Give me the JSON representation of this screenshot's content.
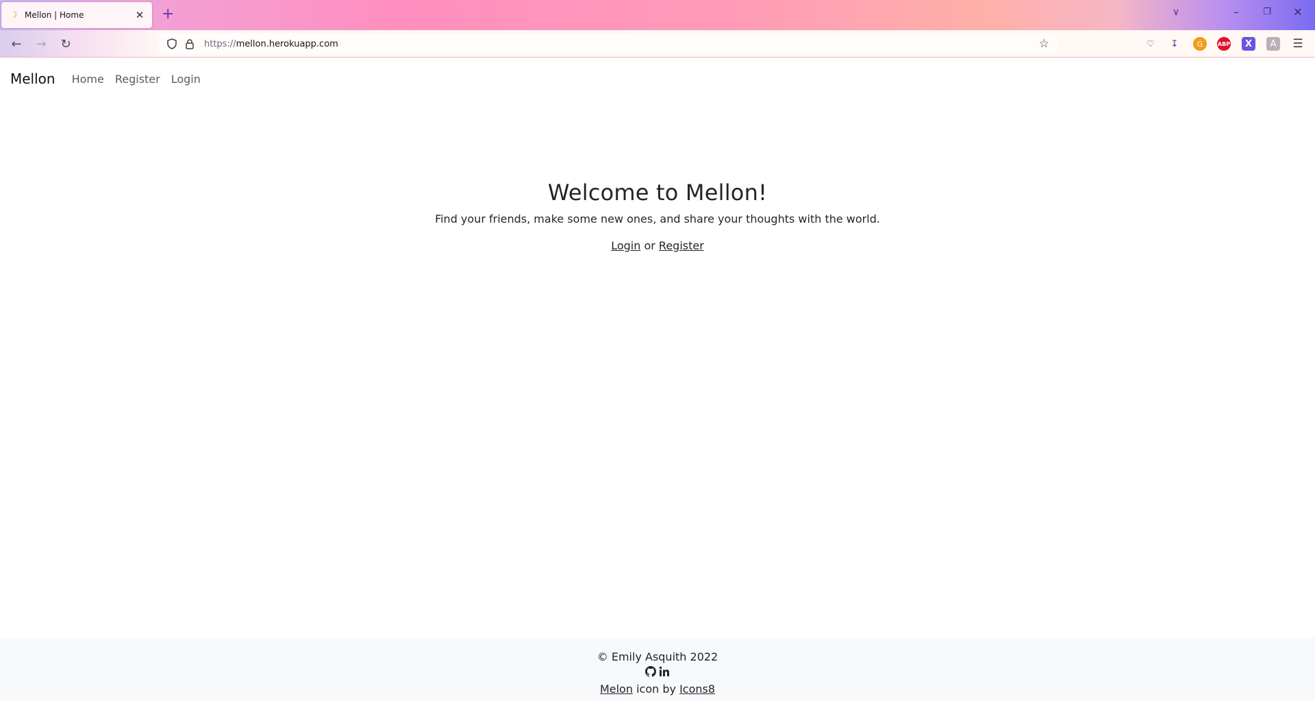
{
  "browser": {
    "tab_title": "Mellon | Home",
    "url_protocol": "https://",
    "url_host": "mellon.herokuapp.com"
  },
  "nav": {
    "brand": "Mellon",
    "links": [
      "Home",
      "Register",
      "Login"
    ]
  },
  "hero": {
    "heading": "Welcome to Mellon!",
    "tagline": "Find your friends, make some new ones, and share your thoughts with the world.",
    "login_link": "Login",
    "or_text": "or",
    "register_link": "Register"
  },
  "footer": {
    "copyright": "© Emily Asquith 2022",
    "melon_link": "Melon",
    "icon_by_text": "icon by",
    "icons8_link": "Icons8"
  },
  "colors": {
    "page_bg": "#ffffff",
    "footer_bg": "#f8f9fa",
    "text": "#212529"
  }
}
